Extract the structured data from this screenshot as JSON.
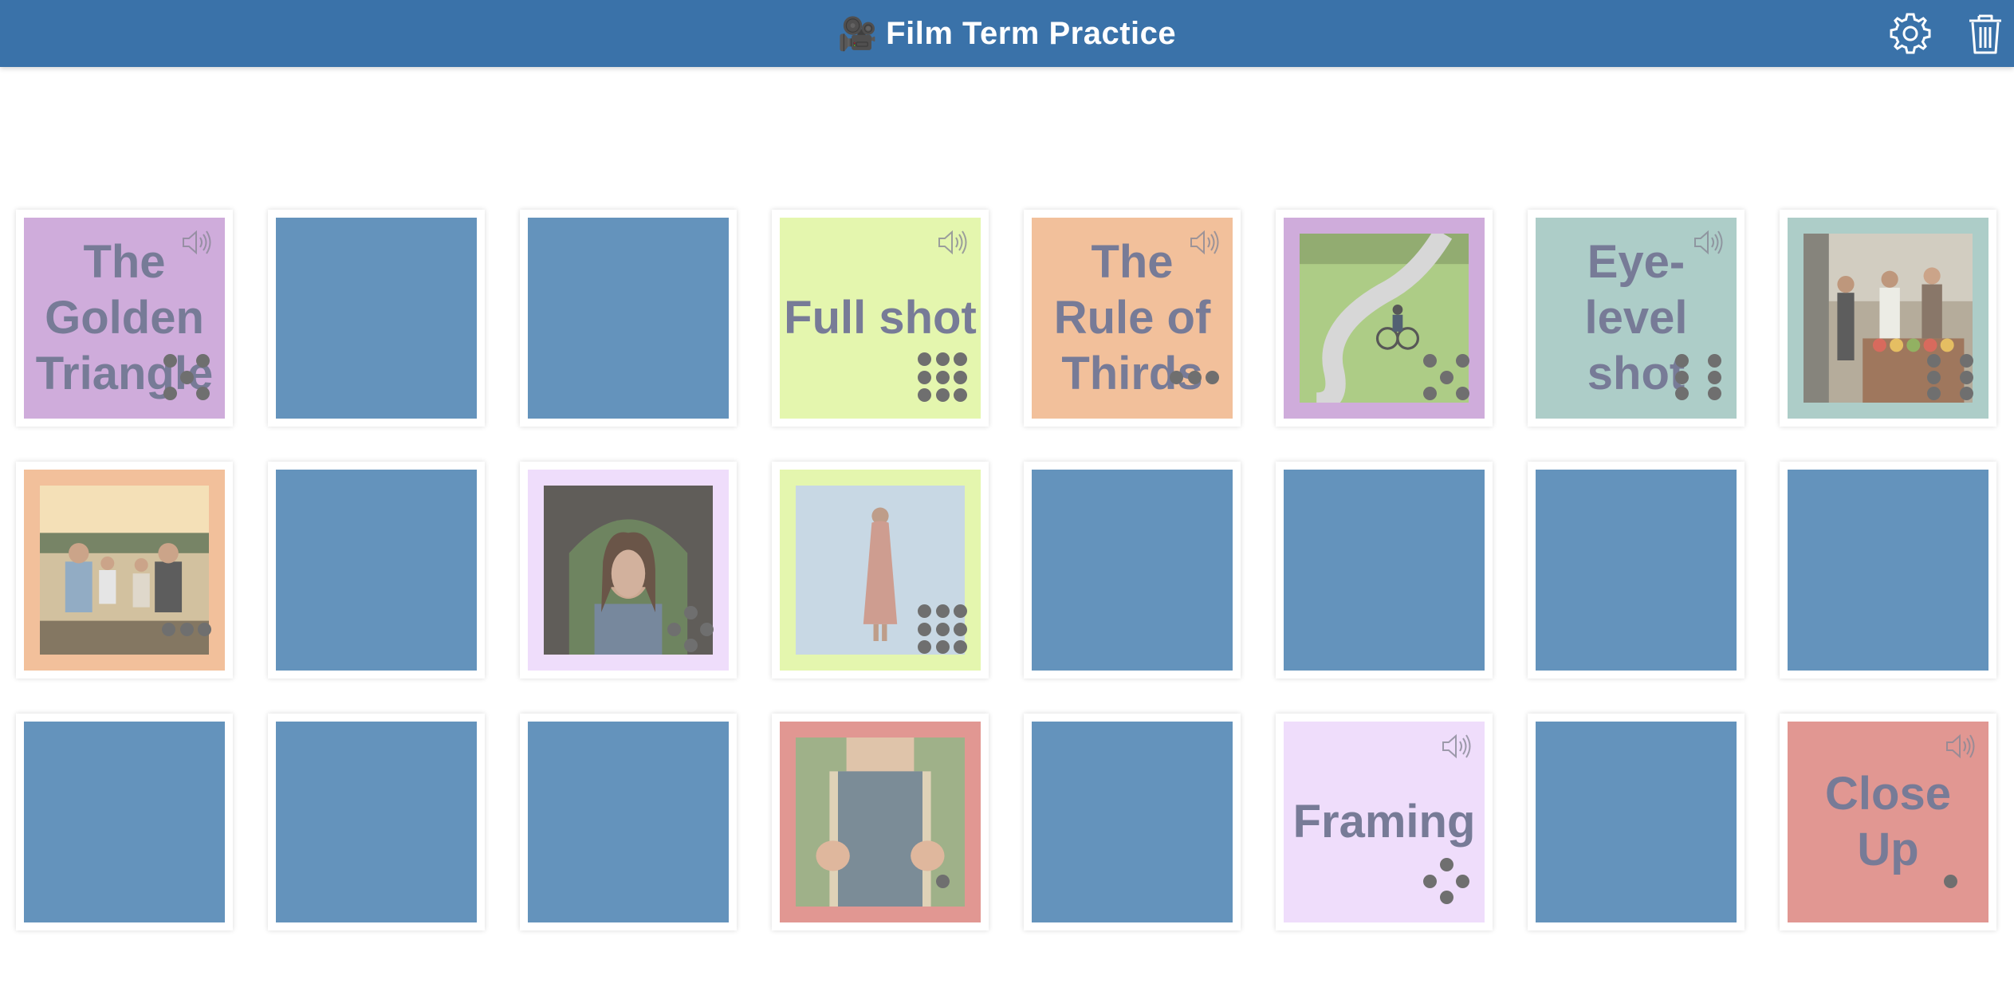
{
  "app": {
    "title": "Film Term Practice",
    "camera_emoji": "🎥",
    "header_color": "#3a72a9"
  },
  "toolbar": {
    "settings_icon": "gear-icon",
    "trash_icon": "trash-icon"
  },
  "colors": {
    "card_back": "#6493bc",
    "purple": "#c59ad3",
    "lime": "#dff59d",
    "orange": "#efb285",
    "teal": "#9cc2bc",
    "lavender": "#ecd6fb",
    "red": "#db807a",
    "word_text": "#5a5f80",
    "dots": "#505050"
  },
  "cards": [
    {
      "row": 0,
      "col": 0,
      "state": "word",
      "text": "The Golden Triangle",
      "color": "purple",
      "dots": 5,
      "audio": true
    },
    {
      "row": 0,
      "col": 1,
      "state": "back"
    },
    {
      "row": 0,
      "col": 2,
      "state": "back"
    },
    {
      "row": 0,
      "col": 3,
      "state": "word",
      "text": "Full shot",
      "color": "lime",
      "dots": 9,
      "audio": true
    },
    {
      "row": 0,
      "col": 4,
      "state": "word",
      "text": "The Rule of Thirds",
      "color": "orange",
      "dots": 3,
      "audio": true
    },
    {
      "row": 0,
      "col": 5,
      "state": "image",
      "image": "cyclist on winding road",
      "color": "purple",
      "dots": 5
    },
    {
      "row": 0,
      "col": 6,
      "state": "word",
      "text": "Eye-level shot",
      "color": "teal",
      "dots": 6,
      "audio": true
    },
    {
      "row": 0,
      "col": 7,
      "state": "image",
      "image": "people at market stall",
      "color": "teal",
      "dots": 6
    },
    {
      "row": 1,
      "col": 0,
      "state": "image",
      "image": "family portrait at sunset",
      "color": "orange",
      "dots": 3
    },
    {
      "row": 1,
      "col": 1,
      "state": "back"
    },
    {
      "row": 1,
      "col": 2,
      "state": "image",
      "image": "woman framed by arch",
      "color": "lavender",
      "dots": 4
    },
    {
      "row": 1,
      "col": 3,
      "state": "image",
      "image": "woman standing full length",
      "color": "lime",
      "dots": 9
    },
    {
      "row": 1,
      "col": 4,
      "state": "back"
    },
    {
      "row": 1,
      "col": 5,
      "state": "back"
    },
    {
      "row": 1,
      "col": 6,
      "state": "back"
    },
    {
      "row": 1,
      "col": 7,
      "state": "back"
    },
    {
      "row": 2,
      "col": 0,
      "state": "back"
    },
    {
      "row": 2,
      "col": 1,
      "state": "back"
    },
    {
      "row": 2,
      "col": 2,
      "state": "back"
    },
    {
      "row": 2,
      "col": 3,
      "state": "image",
      "image": "hands holding book close up",
      "color": "red",
      "dots": 1
    },
    {
      "row": 2,
      "col": 4,
      "state": "back"
    },
    {
      "row": 2,
      "col": 5,
      "state": "word",
      "text": "Framing",
      "color": "lavender",
      "dots": 4,
      "audio": true
    },
    {
      "row": 2,
      "col": 6,
      "state": "back"
    },
    {
      "row": 2,
      "col": 7,
      "state": "word",
      "text": "Close Up",
      "color": "red",
      "dots": 1,
      "audio": true
    }
  ]
}
